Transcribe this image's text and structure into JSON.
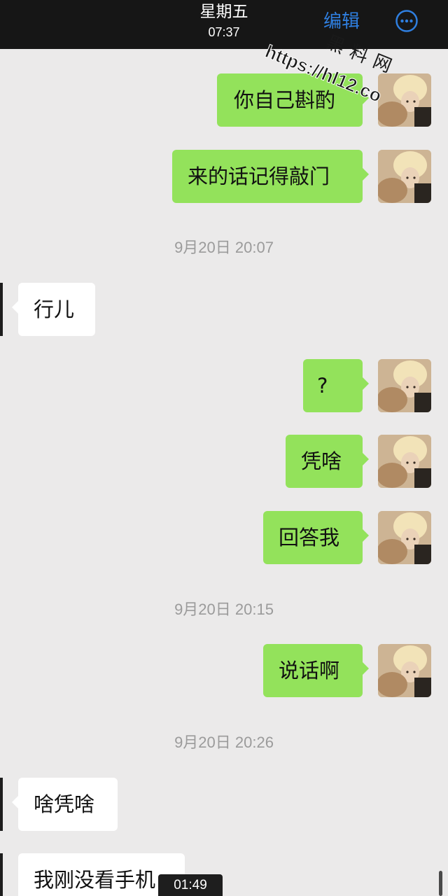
{
  "header": {
    "day": "星期五",
    "time": "07:37",
    "edit_label": "编辑",
    "more_icon": "more-circle-icon"
  },
  "watermark": {
    "line1": "黑料网",
    "line2": "https://hl12.co"
  },
  "messages": [
    {
      "type": "out",
      "text": "你自己斟酌"
    },
    {
      "type": "out",
      "text": "来的话记得敲门"
    },
    {
      "type": "timestamp",
      "text": "9月20日 20:07"
    },
    {
      "type": "in",
      "text": "行儿"
    },
    {
      "type": "out",
      "text": "?"
    },
    {
      "type": "out",
      "text": "凭啥"
    },
    {
      "type": "out",
      "text": "回答我"
    },
    {
      "type": "timestamp",
      "text": "9月20日 20:15"
    },
    {
      "type": "out",
      "text": "说话啊"
    },
    {
      "type": "timestamp",
      "text": "9月20日 20:26"
    },
    {
      "type": "in",
      "text": "啥凭啥"
    },
    {
      "type": "in",
      "text": "我刚没看手机"
    }
  ],
  "video": {
    "duration": "01:49"
  },
  "colors": {
    "outgoing_bubble": "#93e25b",
    "incoming_bubble": "#ffffff",
    "background": "#ebeaea",
    "accent": "#2f7fe0",
    "timestamp": "#9b9b9b"
  }
}
